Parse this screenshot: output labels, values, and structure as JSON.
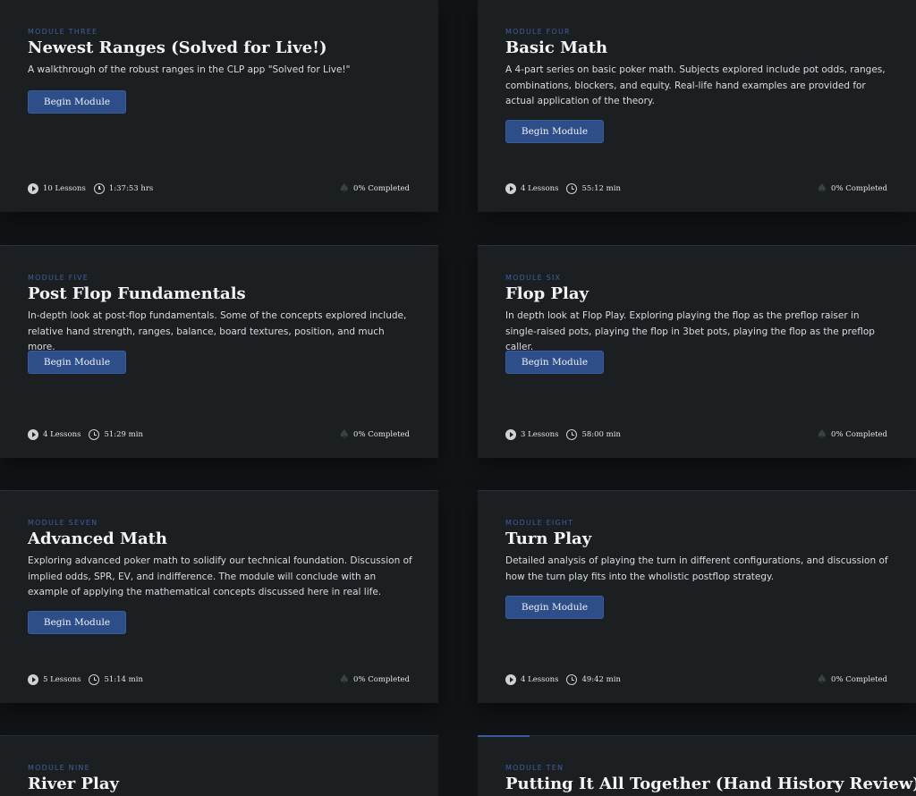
{
  "modules": [
    {
      "label": "MODULE THREE",
      "title": "Newest Ranges (Solved for Live!)",
      "description": "A walkthrough of the robust ranges in the CLP app \"Solved for Live!\"",
      "button": "Begin Module",
      "lessons": "10 Lessons",
      "duration": "1:37:53 hrs",
      "completed": "0% Completed"
    },
    {
      "label": "MODULE FOUR",
      "title": "Basic Math",
      "description": "A 4-part series on basic poker math. Subjects explored include pot odds, ranges, combinations, blockers, and equity. Real-life hand examples are provided for actual application of the theory.",
      "button": "Begin Module",
      "lessons": "4 Lessons",
      "duration": "55:12 min",
      "completed": "0% Completed"
    },
    {
      "label": "MODULE FIVE",
      "title": "Post Flop Fundamentals",
      "description": "In-depth look at post-flop fundamentals. Some of the concepts explored include, relative hand strength, ranges, balance, board textures, position, and much more.",
      "button": "Begin Module",
      "lessons": "4 Lessons",
      "duration": "51:29 min",
      "completed": "0% Completed"
    },
    {
      "label": "MODULE SIX",
      "title": "Flop Play",
      "description": "In depth look at Flop Play. Exploring playing the flop as the preflop raiser in single-raised pots, playing the flop in 3bet pots, playing the flop as the preflop caller.",
      "button": "Begin Module",
      "lessons": "3 Lessons",
      "duration": "58:00 min",
      "completed": "0% Completed"
    },
    {
      "label": "MODULE SEVEN",
      "title": "Advanced Math",
      "description": "Exploring advanced poker math to solidify our technical foundation. Discussion of implied odds, SPR, EV, and indifference. The module will conclude with an example of applying the mathematical concepts discussed here in real life.",
      "button": "Begin Module",
      "lessons": "5 Lessons",
      "duration": "51:14 min",
      "completed": "0% Completed"
    },
    {
      "label": "MODULE EIGHT",
      "title": "Turn Play",
      "description": "Detailed analysis of playing the turn in different configurations, and discussion of how the turn play fits into the wholistic postflop strategy.",
      "button": "Begin Module",
      "lessons": "4 Lessons",
      "duration": "49:42 min",
      "completed": "0% Completed"
    },
    {
      "label": "MODULE NINE",
      "title": "River Play"
    },
    {
      "label": "MODULE TEN",
      "title": "Putting It All Together (Hand History Review)"
    }
  ]
}
